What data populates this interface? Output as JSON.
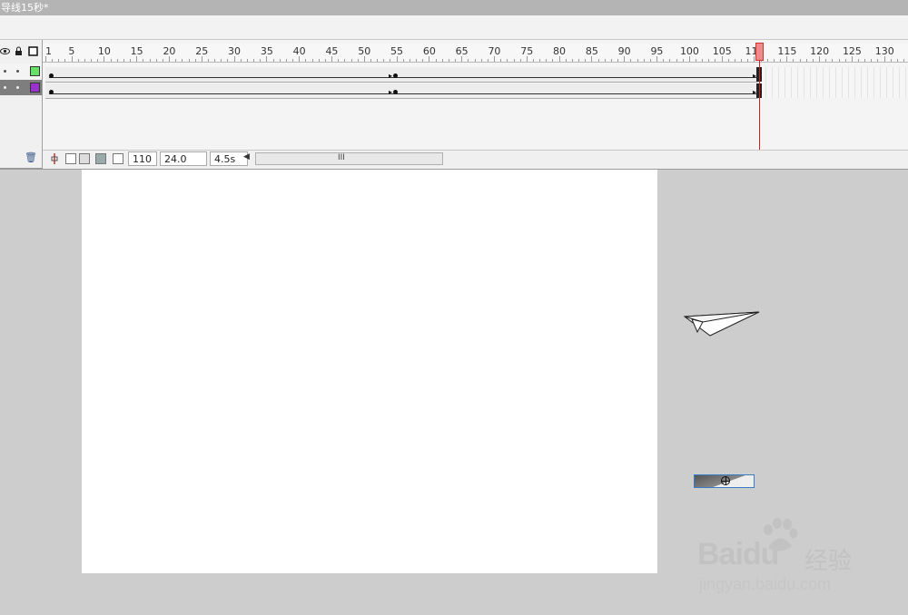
{
  "window": {
    "title": "导线15秒*"
  },
  "timeline": {
    "ruler_labels": [
      "1",
      "5",
      "10",
      "15",
      "20",
      "25",
      "30",
      "35",
      "40",
      "45",
      "50",
      "55",
      "60",
      "65",
      "70",
      "75",
      "80",
      "85",
      "90",
      "95",
      "100",
      "105",
      "110",
      "115",
      "120",
      "125",
      "130"
    ],
    "current_frame": 110,
    "layers": [
      {
        "color": "#66e066",
        "selected": false
      },
      {
        "color": "#9933cc",
        "selected": true
      }
    ],
    "keyframes": [
      1,
      54,
      110
    ]
  },
  "status": {
    "frame": "110",
    "fps": "24.0 fps",
    "time": "4.5s",
    "scroll_grip": "III"
  },
  "watermark": {
    "brand": "Baidu",
    "sub": "经验",
    "url": "jingyan.baidu.com"
  },
  "icons": {
    "header": [
      "eye-icon",
      "lock-icon",
      "outline-icon"
    ],
    "delete": "trash-icon",
    "onion": [
      "center-frame-icon",
      "onion-skin-icon",
      "onion-outline-icon",
      "edit-multiple-icon",
      "modify-markers-icon"
    ]
  }
}
